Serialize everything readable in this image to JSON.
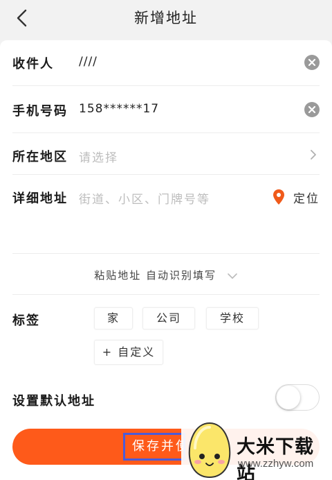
{
  "header": {
    "title": "新增地址",
    "back_icon": "back-arrow-icon"
  },
  "form": {
    "recipient": {
      "label": "收件人",
      "value": "////"
    },
    "phone": {
      "label": "手机号码",
      "value": "158******17"
    },
    "region": {
      "label": "所在地区",
      "placeholder": "请选择"
    },
    "address": {
      "label": "详细地址",
      "placeholder": "街道、小区、门牌号等",
      "locate_label": "定位"
    },
    "paste_label": "粘贴地址 自动识别填写",
    "tags": {
      "label": "标签",
      "items": [
        "家",
        "公司",
        "学校"
      ],
      "custom": "+ 自定义"
    },
    "default": {
      "label": "设置默认地址",
      "enabled": false
    }
  },
  "save_button": {
    "label": "保存并使"
  },
  "watermark": {
    "name": "大米下载站",
    "url": "www.zzhyw.com"
  },
  "colors": {
    "accent": "#fe5a1a",
    "location_pin": "#f05a1a"
  }
}
